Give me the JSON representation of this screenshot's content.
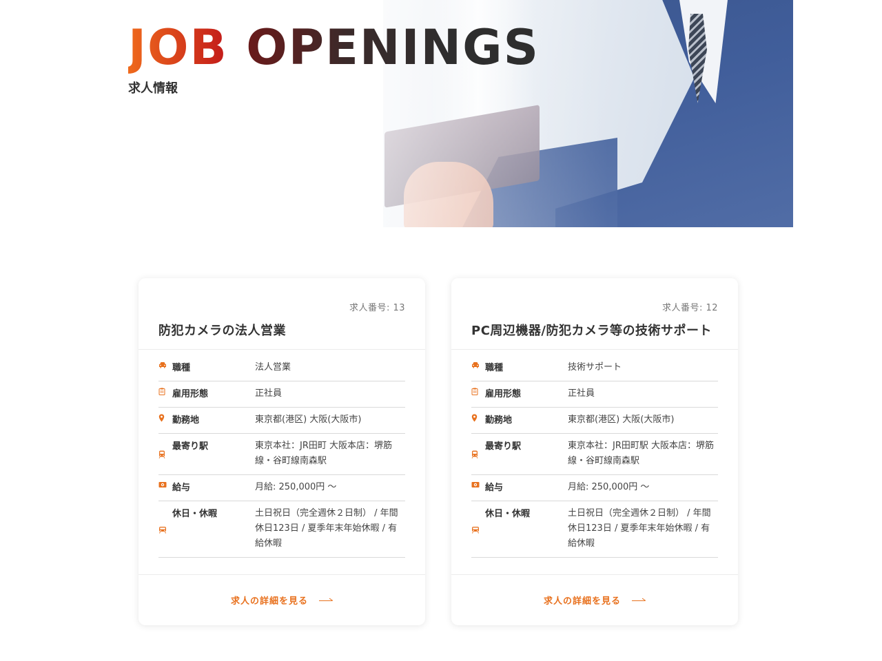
{
  "hero": {
    "title_word1": "JOB",
    "title_word2": "OPENINGS",
    "subtitle": "求人情報"
  },
  "colors": {
    "accent": "#e8711e",
    "title_gradient_start": "#ef6a1c",
    "title_gradient_end": "#c21a1a",
    "text": "#333333"
  },
  "jobs": [
    {
      "job_number": "求人番号: 13",
      "title": "防犯カメラの法人営業",
      "rows": [
        {
          "icon": "car-icon",
          "label": "職種",
          "value": "法人営業"
        },
        {
          "icon": "clipboard-icon",
          "label": "雇用形態",
          "value": "正社員"
        },
        {
          "icon": "map-pin-icon",
          "label": "勤務地",
          "value": "東京都(港区)  大阪(大阪市)"
        },
        {
          "icon": "train-icon",
          "label": "最寄り駅",
          "value": "東京本社：JR田町 大阪本店：堺筋線・谷町線南森駅"
        },
        {
          "icon": "money-icon",
          "label": "給与",
          "value": "月給: 250,000円 〜"
        },
        {
          "icon": "train-icon",
          "label": "休日・休暇",
          "value": "土日祝日（完全週休２日制） / 年間休日123日 / 夏季年末年始休暇 / 有給休暇"
        }
      ],
      "detail_label": "求人の詳細を見る"
    },
    {
      "job_number": "求人番号: 12",
      "title": "PC周辺機器/防犯カメラ等の技術サポート",
      "rows": [
        {
          "icon": "car-icon",
          "label": "職種",
          "value": "技術サポート"
        },
        {
          "icon": "clipboard-icon",
          "label": "雇用形態",
          "value": "正社員"
        },
        {
          "icon": "map-pin-icon",
          "label": "勤務地",
          "value": "東京都(港区)  大阪(大阪市)"
        },
        {
          "icon": "train-icon",
          "label": "最寄り駅",
          "value": "東京本社：JR田町駅 大阪本店：堺筋線・谷町線南森駅"
        },
        {
          "icon": "money-icon",
          "label": "給与",
          "value": "月給: 250,000円 〜"
        },
        {
          "icon": "train-icon",
          "label": "休日・休暇",
          "value": "土日祝日（完全週休２日制） / 年間休日123日 / 夏季年末年始休暇 / 有給休暇"
        }
      ],
      "detail_label": "求人の詳細を見る"
    }
  ]
}
